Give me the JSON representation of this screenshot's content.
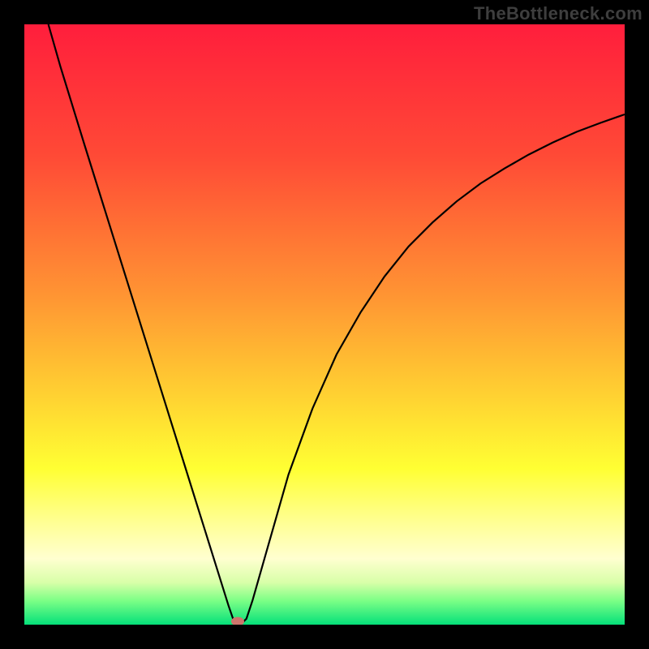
{
  "watermark": "TheBottleneck.com",
  "chart_data": {
    "type": "line",
    "title": "",
    "xlabel": "",
    "ylabel": "",
    "xlim": [
      0,
      100
    ],
    "ylim": [
      0,
      100
    ],
    "grid": false,
    "legend": false,
    "background_gradient_stops": [
      {
        "pct": 0,
        "color": "#ff1e3c"
      },
      {
        "pct": 22,
        "color": "#ff4a36"
      },
      {
        "pct": 45,
        "color": "#ff9433"
      },
      {
        "pct": 62,
        "color": "#ffd232"
      },
      {
        "pct": 74,
        "color": "#ffff33"
      },
      {
        "pct": 82,
        "color": "#ffff8a"
      },
      {
        "pct": 89,
        "color": "#ffffd0"
      },
      {
        "pct": 93,
        "color": "#d8ffa8"
      },
      {
        "pct": 96,
        "color": "#7cff86"
      },
      {
        "pct": 100,
        "color": "#05e07a"
      }
    ],
    "series": [
      {
        "name": "bottleneck-curve",
        "color": "#000000",
        "x": [
          4,
          6,
          8,
          10,
          12,
          14,
          16,
          18,
          20,
          22,
          24,
          26,
          28,
          30,
          32,
          34,
          35,
          36,
          37,
          38,
          40,
          42,
          44,
          48,
          52,
          56,
          60,
          64,
          68,
          72,
          76,
          80,
          84,
          88,
          92,
          96,
          100
        ],
        "y": [
          100,
          93,
          86.5,
          80,
          73.6,
          67.2,
          60.8,
          54.4,
          48,
          41.6,
          35.2,
          28.8,
          22.4,
          16,
          9.6,
          3.2,
          0.3,
          0,
          1,
          4,
          11,
          18,
          25,
          36,
          45,
          52,
          58,
          63,
          67,
          70.5,
          73.5,
          76,
          78.3,
          80.3,
          82.1,
          83.6,
          85
        ]
      }
    ],
    "marker": {
      "x": 35.5,
      "y": 0.5,
      "color": "#cd756c"
    }
  }
}
